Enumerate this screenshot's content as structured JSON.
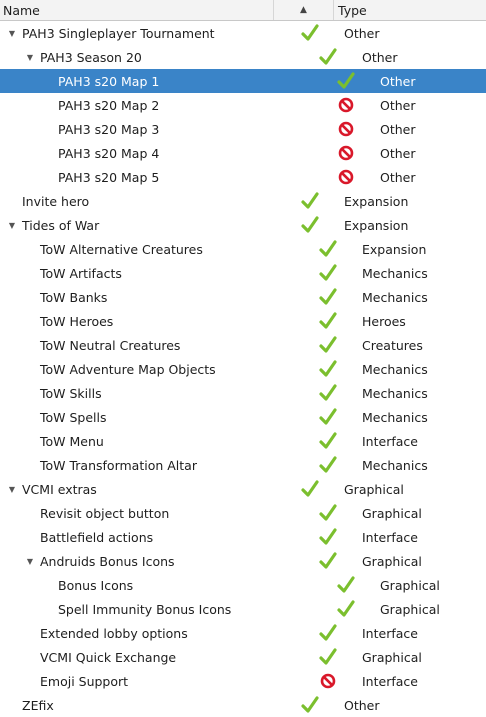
{
  "header": {
    "name": "Name",
    "sort_indicator": "▲",
    "type": "Type"
  },
  "status_icons": {
    "enabled": "check-icon",
    "disabled": "blocked-icon"
  },
  "colors": {
    "selection": "#3a84c8",
    "check": "#7bbf2e",
    "blocked": "#d9182a"
  },
  "rows": [
    {
      "name": "PAH3 Singleplayer Tournament",
      "type": "Other",
      "level": 0,
      "expander": "expanded",
      "status": "enabled",
      "selected": false
    },
    {
      "name": "PAH3 Season 20",
      "type": "Other",
      "level": 1,
      "expander": "expanded",
      "status": "enabled",
      "selected": false
    },
    {
      "name": "PAH3 s20 Map 1",
      "type": "Other",
      "level": 2,
      "expander": "none",
      "status": "enabled",
      "selected": true
    },
    {
      "name": "PAH3 s20 Map 2",
      "type": "Other",
      "level": 2,
      "expander": "none",
      "status": "disabled",
      "selected": false
    },
    {
      "name": "PAH3 s20 Map 3",
      "type": "Other",
      "level": 2,
      "expander": "none",
      "status": "disabled",
      "selected": false
    },
    {
      "name": "PAH3 s20 Map 4",
      "type": "Other",
      "level": 2,
      "expander": "none",
      "status": "disabled",
      "selected": false
    },
    {
      "name": "PAH3 s20 Map 5",
      "type": "Other",
      "level": 2,
      "expander": "none",
      "status": "disabled",
      "selected": false
    },
    {
      "name": "Invite hero",
      "type": "Expansion",
      "level": 0,
      "expander": "none",
      "status": "enabled",
      "selected": false
    },
    {
      "name": "Tides of War",
      "type": "Expansion",
      "level": 0,
      "expander": "expanded",
      "status": "enabled",
      "selected": false
    },
    {
      "name": "ToW Alternative Creatures",
      "type": "Expansion",
      "level": 1,
      "expander": "none",
      "status": "enabled",
      "selected": false
    },
    {
      "name": "ToW Artifacts",
      "type": "Mechanics",
      "level": 1,
      "expander": "none",
      "status": "enabled",
      "selected": false
    },
    {
      "name": "ToW Banks",
      "type": "Mechanics",
      "level": 1,
      "expander": "none",
      "status": "enabled",
      "selected": false
    },
    {
      "name": "ToW Heroes",
      "type": "Heroes",
      "level": 1,
      "expander": "none",
      "status": "enabled",
      "selected": false
    },
    {
      "name": "ToW Neutral Creatures",
      "type": "Creatures",
      "level": 1,
      "expander": "none",
      "status": "enabled",
      "selected": false
    },
    {
      "name": "ToW Adventure Map Objects",
      "type": "Mechanics",
      "level": 1,
      "expander": "none",
      "status": "enabled",
      "selected": false
    },
    {
      "name": "ToW Skills",
      "type": "Mechanics",
      "level": 1,
      "expander": "none",
      "status": "enabled",
      "selected": false
    },
    {
      "name": "ToW Spells",
      "type": "Mechanics",
      "level": 1,
      "expander": "none",
      "status": "enabled",
      "selected": false
    },
    {
      "name": "ToW Menu",
      "type": "Interface",
      "level": 1,
      "expander": "none",
      "status": "enabled",
      "selected": false
    },
    {
      "name": "ToW Transformation Altar",
      "type": "Mechanics",
      "level": 1,
      "expander": "none",
      "status": "enabled",
      "selected": false
    },
    {
      "name": "VCMI extras",
      "type": "Graphical",
      "level": 0,
      "expander": "expanded",
      "status": "enabled",
      "selected": false
    },
    {
      "name": "Revisit object button",
      "type": "Graphical",
      "level": 1,
      "expander": "none",
      "status": "enabled",
      "selected": false
    },
    {
      "name": "Battlefield actions",
      "type": "Interface",
      "level": 1,
      "expander": "none",
      "status": "enabled",
      "selected": false
    },
    {
      "name": "Andruids Bonus Icons",
      "type": "Graphical",
      "level": 1,
      "expander": "expanded",
      "status": "enabled",
      "selected": false
    },
    {
      "name": "Bonus Icons",
      "type": "Graphical",
      "level": 2,
      "expander": "none",
      "status": "enabled",
      "selected": false
    },
    {
      "name": "Spell Immunity Bonus Icons",
      "type": "Graphical",
      "level": 2,
      "expander": "none",
      "status": "enabled",
      "selected": false
    },
    {
      "name": "Extended lobby options",
      "type": "Interface",
      "level": 1,
      "expander": "none",
      "status": "enabled",
      "selected": false
    },
    {
      "name": "VCMI Quick Exchange",
      "type": "Graphical",
      "level": 1,
      "expander": "none",
      "status": "enabled",
      "selected": false
    },
    {
      "name": "Emoji Support",
      "type": "Interface",
      "level": 1,
      "expander": "none",
      "status": "disabled",
      "selected": false
    },
    {
      "name": "ZEfix",
      "type": "Other",
      "level": 0,
      "expander": "none",
      "status": "enabled",
      "selected": false
    }
  ]
}
